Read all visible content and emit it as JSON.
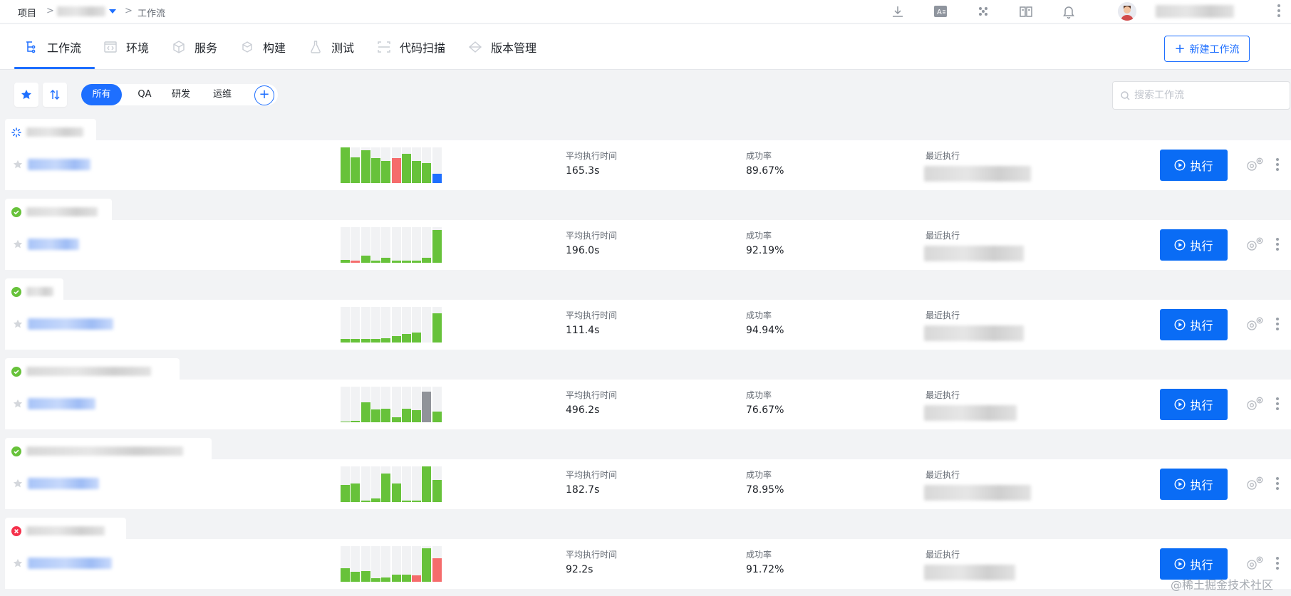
{
  "breadcrumb": {
    "root": "项目",
    "separator": ">",
    "current": "工作流"
  },
  "top_icons": [
    "download-icon",
    "translate-icon",
    "apps-icon",
    "docs-icon",
    "bell-icon"
  ],
  "nav": {
    "tabs": [
      {
        "label": "工作流",
        "icon": "workflow-icon",
        "active": true
      },
      {
        "label": "环境",
        "icon": "code-icon"
      },
      {
        "label": "服务",
        "icon": "cube-icon"
      },
      {
        "label": "构建",
        "icon": "hexagon-icon"
      },
      {
        "label": "测试",
        "icon": "flask-icon"
      },
      {
        "label": "代码扫描",
        "icon": "scan-icon"
      },
      {
        "label": "版本管理",
        "icon": "diamond-icon"
      }
    ],
    "new_button": "新建工作流"
  },
  "filters": {
    "chips": [
      "所有",
      "QA",
      "研发",
      "运维"
    ],
    "active": "所有",
    "add_symbol": "+"
  },
  "search": {
    "placeholder": "搜索工作流"
  },
  "colors": {
    "primary": "#1e6fff",
    "run_button": "#0a6cf5",
    "success": "#67c23a",
    "fail": "#f56c6c",
    "running": "#1e6fff",
    "cancelled": "#909399"
  },
  "labels": {
    "avg_time": "平均执行时间",
    "success_rate": "成功率",
    "recent": "最近执行",
    "run": "执行"
  },
  "workflows": [
    {
      "status": "running",
      "avg_time": "165.3s",
      "success_rate": "89.67%",
      "bars": [
        {
          "h": 1.0,
          "c": "success"
        },
        {
          "h": 0.72,
          "c": "success"
        },
        {
          "h": 0.92,
          "c": "success"
        },
        {
          "h": 0.7,
          "c": "success"
        },
        {
          "h": 0.62,
          "c": "success"
        },
        {
          "h": 0.7,
          "c": "fail"
        },
        {
          "h": 0.82,
          "c": "success"
        },
        {
          "h": 0.62,
          "c": "success"
        },
        {
          "h": 0.55,
          "c": "success"
        },
        {
          "h": 0.26,
          "c": "running"
        }
      ]
    },
    {
      "status": "success",
      "avg_time": "196.0s",
      "success_rate": "92.19%",
      "bars": [
        {
          "h": 0.08,
          "c": "success"
        },
        {
          "h": 0.06,
          "c": "fail"
        },
        {
          "h": 0.2,
          "c": "success"
        },
        {
          "h": 0.06,
          "c": "success"
        },
        {
          "h": 0.14,
          "c": "success"
        },
        {
          "h": 0.06,
          "c": "success"
        },
        {
          "h": 0.06,
          "c": "success"
        },
        {
          "h": 0.06,
          "c": "success"
        },
        {
          "h": 0.14,
          "c": "success"
        },
        {
          "h": 0.92,
          "c": "success"
        }
      ]
    },
    {
      "status": "success",
      "avg_time": "111.4s",
      "success_rate": "94.94%",
      "bars": [
        {
          "h": 0.1,
          "c": "success"
        },
        {
          "h": 0.1,
          "c": "success"
        },
        {
          "h": 0.1,
          "c": "success"
        },
        {
          "h": 0.1,
          "c": "success"
        },
        {
          "h": 0.12,
          "c": "success"
        },
        {
          "h": 0.18,
          "c": "success"
        },
        {
          "h": 0.24,
          "c": "success"
        },
        {
          "h": 0.28,
          "c": "success"
        },
        {
          "h": 0.0,
          "c": "success"
        },
        {
          "h": 0.82,
          "c": "success"
        }
      ]
    },
    {
      "status": "success",
      "avg_time": "496.2s",
      "success_rate": "76.67%",
      "bars": [
        {
          "h": 0.02,
          "c": "success"
        },
        {
          "h": 0.04,
          "c": "success"
        },
        {
          "h": 0.56,
          "c": "success"
        },
        {
          "h": 0.36,
          "c": "success"
        },
        {
          "h": 0.38,
          "c": "success"
        },
        {
          "h": 0.14,
          "c": "success"
        },
        {
          "h": 0.38,
          "c": "success"
        },
        {
          "h": 0.34,
          "c": "success"
        },
        {
          "h": 0.86,
          "c": "cancelled"
        },
        {
          "h": 0.3,
          "c": "success"
        }
      ]
    },
    {
      "status": "success",
      "avg_time": "182.7s",
      "success_rate": "78.95%",
      "bars": [
        {
          "h": 0.48,
          "c": "success"
        },
        {
          "h": 0.52,
          "c": "success"
        },
        {
          "h": 0.04,
          "c": "success"
        },
        {
          "h": 0.1,
          "c": "success"
        },
        {
          "h": 0.8,
          "c": "success"
        },
        {
          "h": 0.52,
          "c": "success"
        },
        {
          "h": 0.04,
          "c": "success"
        },
        {
          "h": 0.04,
          "c": "success"
        },
        {
          "h": 1.0,
          "c": "success"
        },
        {
          "h": 0.62,
          "c": "success"
        }
      ]
    },
    {
      "status": "fail",
      "avg_time": "92.2s",
      "success_rate": "91.72%",
      "bars": [
        {
          "h": 0.38,
          "c": "success"
        },
        {
          "h": 0.28,
          "c": "success"
        },
        {
          "h": 0.3,
          "c": "success"
        },
        {
          "h": 0.1,
          "c": "success"
        },
        {
          "h": 0.12,
          "c": "success"
        },
        {
          "h": 0.2,
          "c": "success"
        },
        {
          "h": 0.2,
          "c": "success"
        },
        {
          "h": 0.18,
          "c": "fail"
        },
        {
          "h": 0.94,
          "c": "success"
        },
        {
          "h": 0.66,
          "c": "fail"
        }
      ]
    }
  ],
  "watermark": "@稀土掘金技术社区"
}
